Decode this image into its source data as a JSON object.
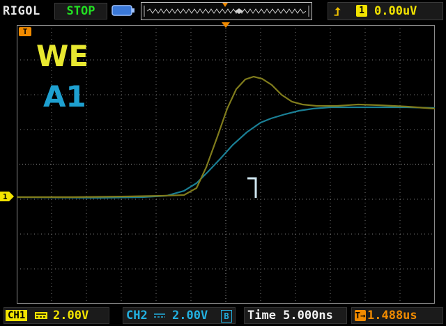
{
  "header": {
    "brand": "RIGOL",
    "run_state": "STOP",
    "trigger": {
      "edge_icon": "rising-edge-icon",
      "channel": "1",
      "level": "0.00uV"
    }
  },
  "markers": {
    "trigger_position": "T",
    "channel1_ground": "1"
  },
  "screen": {
    "label_we": "WE",
    "label_a1": "A1"
  },
  "footer": {
    "ch1_name": "CH1",
    "ch1_scale": "2.00V",
    "ch2_name": "CH2",
    "ch2_scale": "2.00V",
    "ch2_bw": "B",
    "time": "Time 5.000ns",
    "offset": "1.488us"
  },
  "colors": {
    "ch1": "#f2e300",
    "ch2": "#1ea0d0",
    "trigger": "#f08a00",
    "grid": "#7a7a7a"
  }
}
